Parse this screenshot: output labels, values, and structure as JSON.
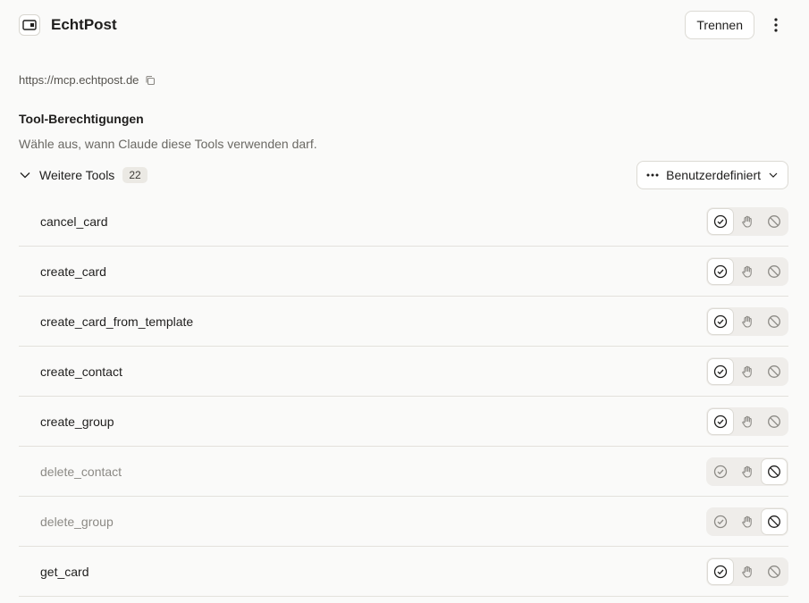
{
  "header": {
    "title": "EchtPost",
    "disconnect_label": "Trennen"
  },
  "server": {
    "url": "https://mcp.echtpost.de"
  },
  "permissions": {
    "title": "Tool-Berechtigungen",
    "description": "Wähle aus, wann Claude diese Tools verwenden darf."
  },
  "group": {
    "label": "Weitere Tools",
    "count": "22",
    "mode_label": "Benutzerdefiniert"
  },
  "tools": [
    {
      "name": "cancel_card",
      "permission": "allow"
    },
    {
      "name": "create_card",
      "permission": "allow"
    },
    {
      "name": "create_card_from_template",
      "permission": "allow"
    },
    {
      "name": "create_contact",
      "permission": "allow"
    },
    {
      "name": "create_group",
      "permission": "allow"
    },
    {
      "name": "delete_contact",
      "permission": "block"
    },
    {
      "name": "delete_group",
      "permission": "block"
    },
    {
      "name": "get_card",
      "permission": "allow"
    }
  ],
  "icons": {
    "allow": "check-circle-icon",
    "ask": "hand-icon",
    "block": "ban-icon"
  }
}
